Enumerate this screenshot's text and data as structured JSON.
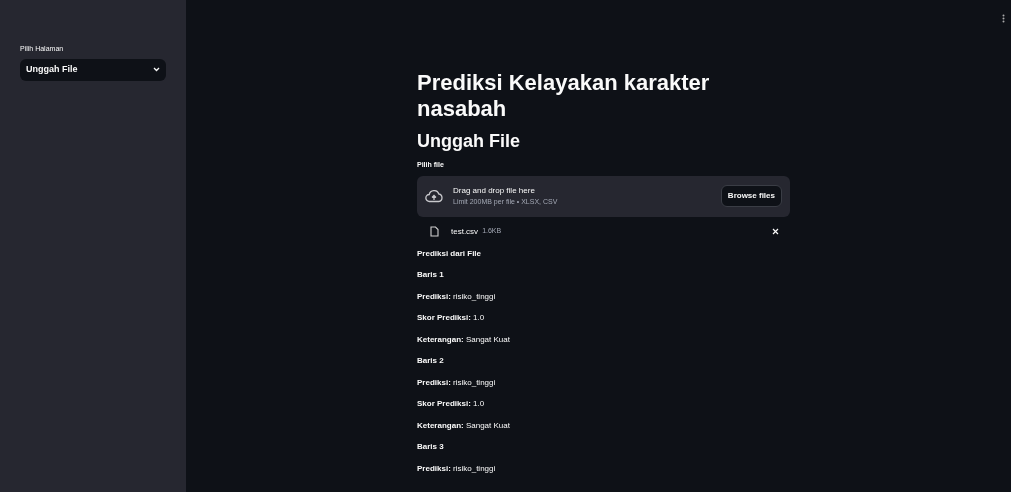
{
  "sidebar": {
    "select_label": "Pilih Halaman",
    "select_value": "Unggah File"
  },
  "title": "Prediksi Kelayakan karakter nasabah",
  "subheader": "Unggah File",
  "uploader": {
    "label": "Pilih file",
    "drop_text": "Drag and drop file here",
    "limit_text": "Limit 200MB per file • XLSX, CSV",
    "button": "Browse files",
    "file": {
      "name": "test.csv",
      "size": "1.6KB"
    }
  },
  "results": [
    {
      "kind": "heading",
      "text": "Prediksi dari File"
    },
    {
      "kind": "heading",
      "text": "Baris 1"
    },
    {
      "kind": "field",
      "text": "**Prediksi:** risiko_tinggi"
    },
    {
      "kind": "field",
      "text": "**Skor Prediksi:** 1.0"
    },
    {
      "kind": "field",
      "text": "**Keterangan:** Sangat Kuat"
    },
    {
      "kind": "heading",
      "text": "Baris 2"
    },
    {
      "kind": "field",
      "text": "**Prediksi:** risiko_tinggi"
    },
    {
      "kind": "field",
      "text": "**Skor Prediksi:** 1.0"
    },
    {
      "kind": "field",
      "text": "**Keterangan:** Sangat Kuat"
    },
    {
      "kind": "heading",
      "text": "Baris 3"
    },
    {
      "kind": "field",
      "text": "**Prediksi:** risiko_tinggi"
    }
  ]
}
